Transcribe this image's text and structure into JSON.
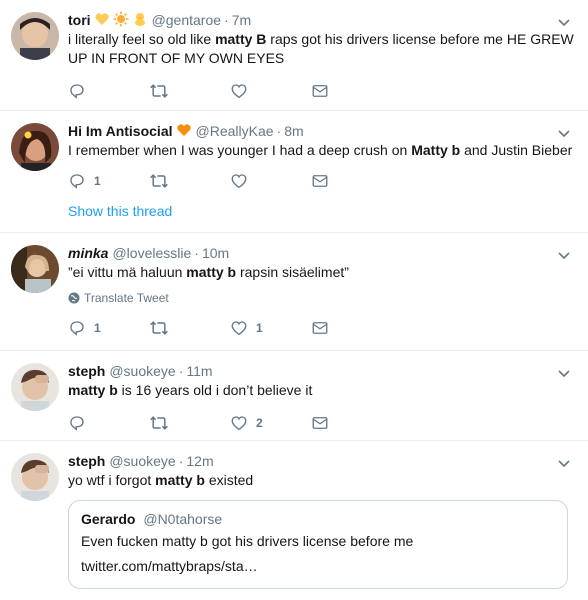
{
  "tweets": [
    {
      "name": "tori",
      "emojis": [
        "yellow-heart",
        "sun",
        "chick"
      ],
      "handle": "@gentaroe",
      "time": "7m",
      "text_parts": [
        "i literally feel so old like ",
        "matty B",
        " raps got his drivers license before me HE GREW UP IN FRONT OF MY OWN EYES"
      ],
      "reply_count": "",
      "like_count": ""
    },
    {
      "name": "Hi Im Antisocial",
      "emojis": [
        "orange-heart"
      ],
      "handle": "@ReallyKae",
      "time": "8m",
      "text_parts": [
        "I remember when I was younger I had a deep crush on ",
        "Matty b",
        " and Justin Bieber"
      ],
      "reply_count": "1",
      "like_count": "",
      "show_thread": "Show this thread"
    },
    {
      "name": "minka",
      "emojis": [],
      "handle": "@lovelesslie",
      "time": "10m",
      "text_parts": [
        "”ei vittu mä haluun ",
        "matty b",
        " rapsin sisäelimet”"
      ],
      "translate": "Translate Tweet",
      "reply_count": "1",
      "like_count": "1"
    },
    {
      "name": "steph",
      "emojis": [],
      "handle": "@suokeye",
      "time": "11m",
      "text_parts": [
        "",
        "matty b",
        " is 16 years old i don’t believe it"
      ],
      "reply_count": "",
      "like_count": "2"
    },
    {
      "name": "steph",
      "emojis": [],
      "handle": "@suokeye",
      "time": "12m",
      "text_parts": [
        "yo wtf i forgot ",
        "matty b",
        " existed"
      ],
      "quote": {
        "name": "Gerardo",
        "handle": "@N0tahorse",
        "text": "Even fucken matty b got his drivers license before me",
        "link": "twitter.com/mattybraps/sta…"
      }
    }
  ],
  "colors": {
    "text": "#14171a",
    "muted": "#657786",
    "link": "#1da1f2",
    "divider": "#e6ecf0"
  }
}
